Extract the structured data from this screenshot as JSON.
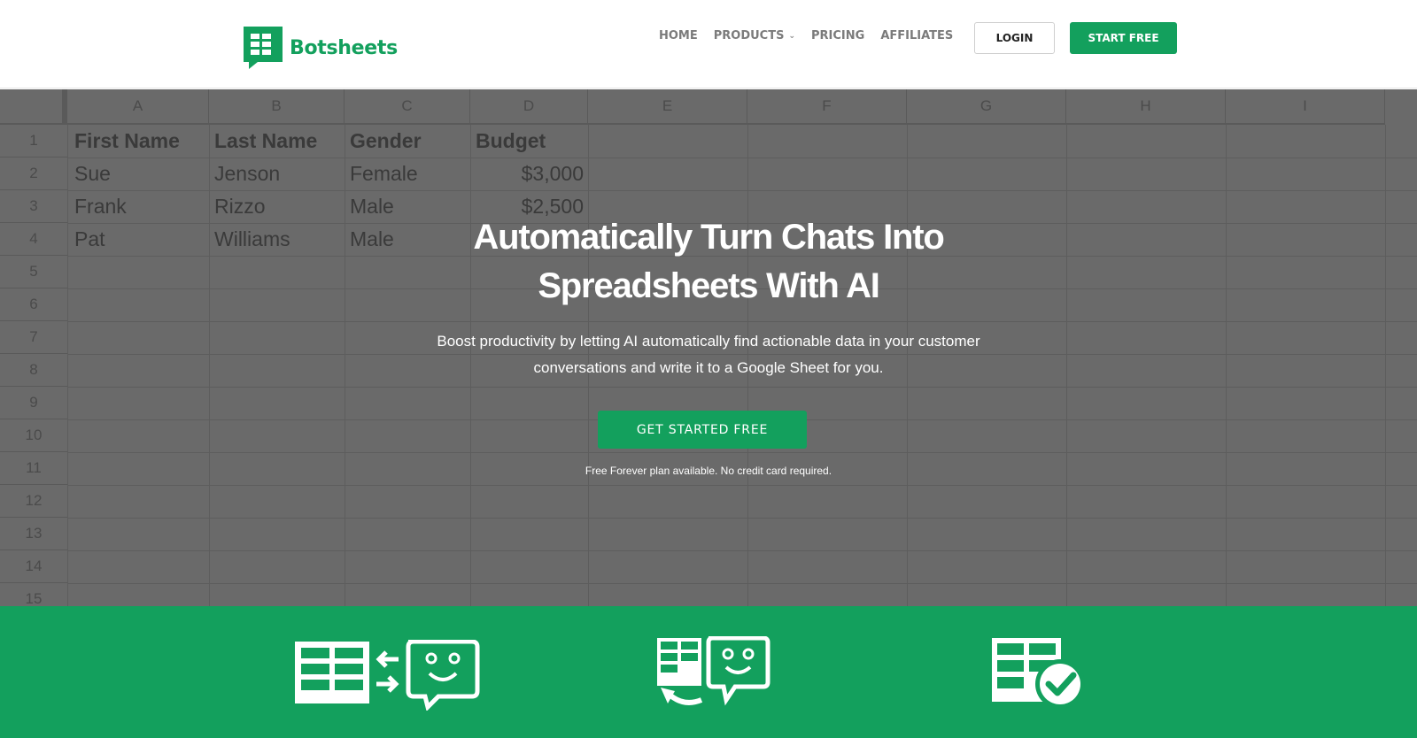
{
  "brand": {
    "name": "Botsheets",
    "color": "#13a05d",
    "icon": "spreadsheet-chat-logo-icon"
  },
  "nav": {
    "items": [
      {
        "label": "HOME"
      },
      {
        "label": "PRODUCTS",
        "has_dropdown": true
      },
      {
        "label": "PRICING"
      },
      {
        "label": "AFFILIATES"
      }
    ],
    "login_label": "LOGIN",
    "start_label": "START FREE"
  },
  "sheet": {
    "columns": [
      "A",
      "B",
      "C",
      "D",
      "E",
      "F",
      "G",
      "H",
      "I"
    ],
    "rows": [
      "1",
      "2",
      "3",
      "4",
      "5",
      "6",
      "7",
      "8",
      "9",
      "10",
      "11",
      "12",
      "13",
      "14",
      "15"
    ],
    "headers": [
      "First Name",
      "Last Name",
      "Gender",
      "Budget"
    ],
    "records": [
      [
        "Sue",
        "Jenson",
        "Female",
        "$3,000"
      ],
      [
        "Frank",
        "Rizzo",
        "Male",
        "$2,500"
      ],
      [
        "Pat",
        "Williams",
        "Male",
        ""
      ]
    ]
  },
  "hero": {
    "title_line1": "Automatically Turn Chats Into",
    "title_line2": "Spreadsheets With AI",
    "subtitle_line1": "Boost productivity by letting AI automatically find actionable data in your customer",
    "subtitle_line2": "conversations and write it to a Google Sheet for you.",
    "cta_label": "GET STARTED FREE",
    "note": "Free Forever plan available. No credit card required.",
    "overlay_color": "#6a6a6a"
  },
  "features": {
    "icons": [
      "sheet-chat-sync-icon",
      "sheet-chat-refresh-icon",
      "sheet-check-icon"
    ]
  }
}
